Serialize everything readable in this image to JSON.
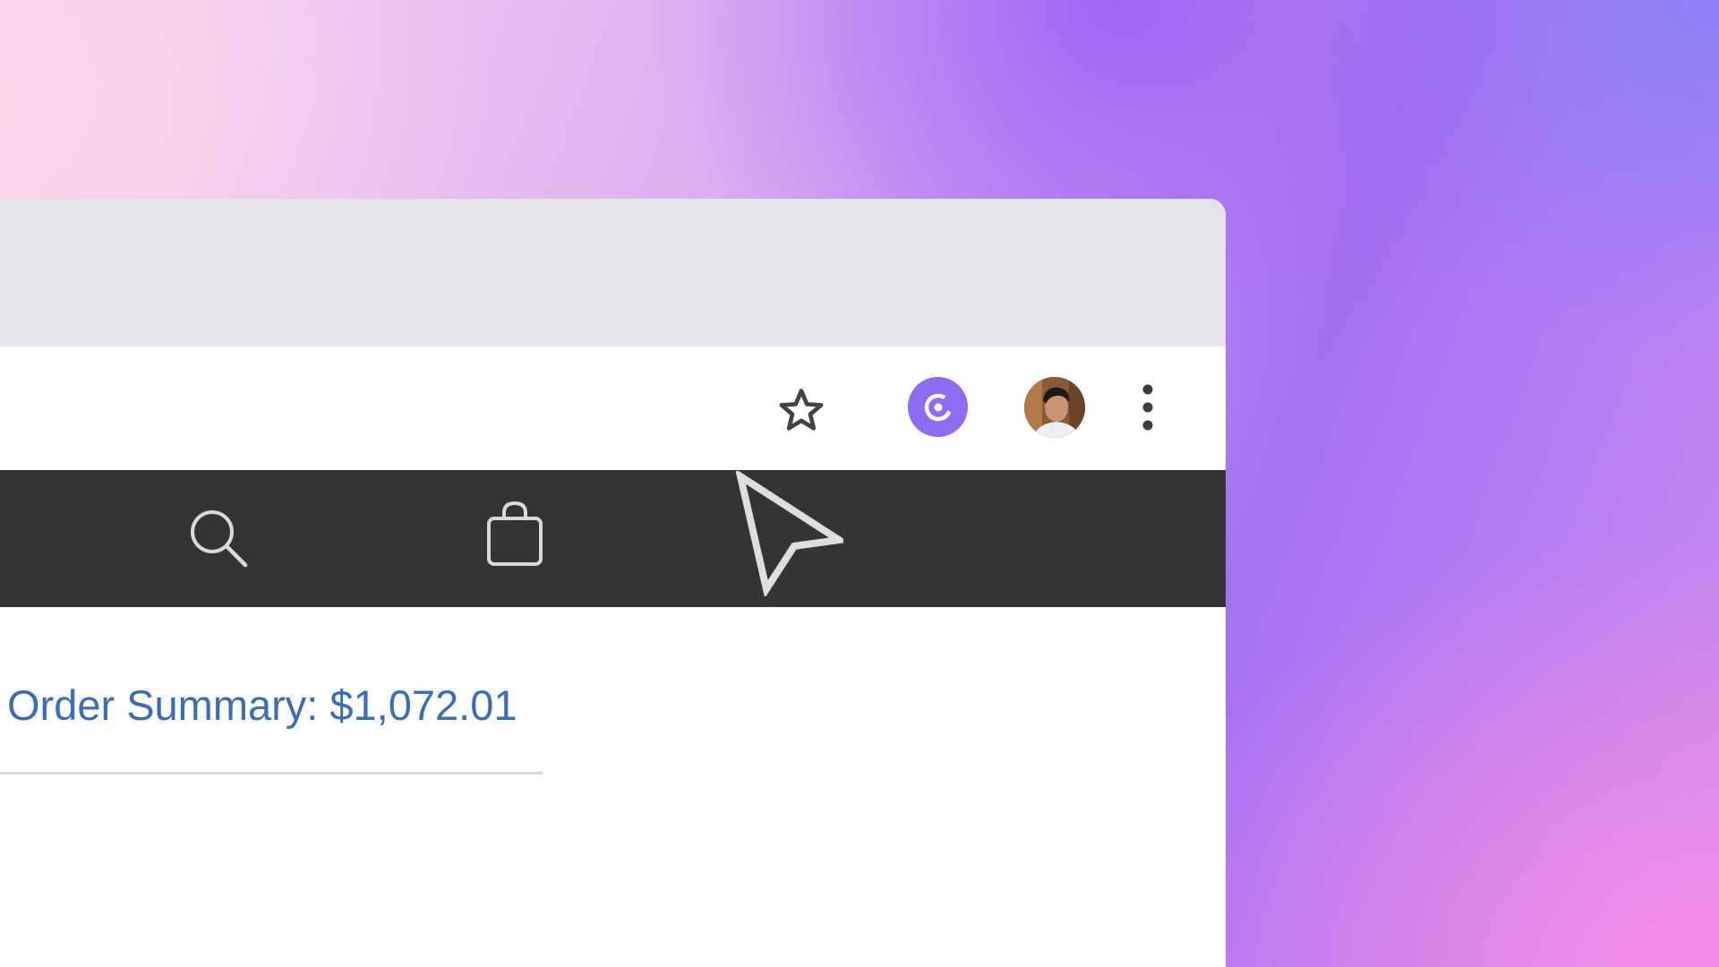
{
  "browser": {
    "bookmark_icon": "star-outline-icon",
    "extension_icon": "extension-c-icon",
    "extension_color": "#8c6cf0",
    "profile_icon": "user-avatar",
    "menu_icon": "vertical-dots-icon"
  },
  "site_nav": {
    "background": "#343434",
    "items": [
      {
        "icon": "search-icon"
      },
      {
        "icon": "shopping-bag-icon"
      }
    ]
  },
  "content": {
    "order_summary": "Order Summary: $1,072.01",
    "accent_color": "#3a6db8"
  }
}
